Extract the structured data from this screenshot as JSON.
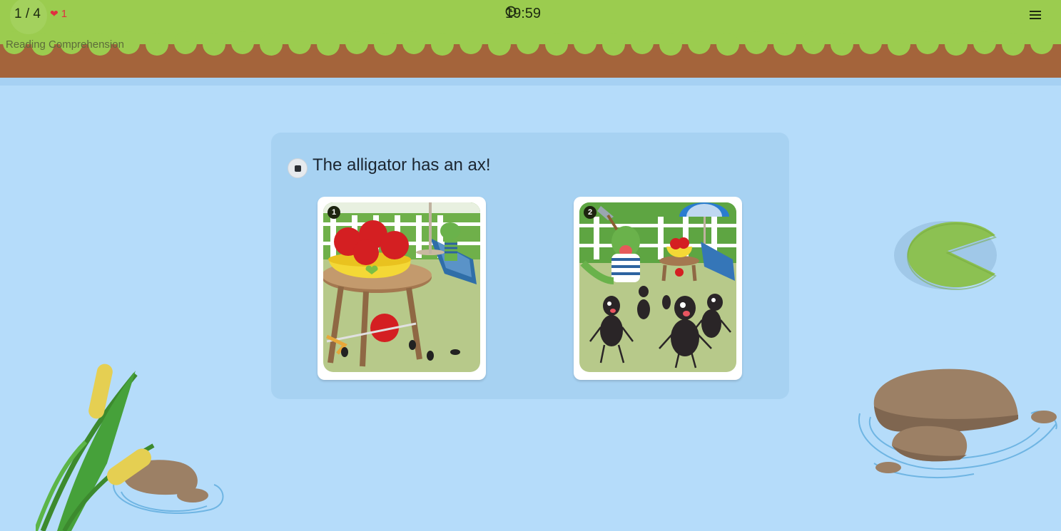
{
  "header": {
    "progress": "1 / 4",
    "lives": "1",
    "timer": "19:59",
    "section_title": "Reading Comprehension",
    "icons": {
      "heart": "heart-icon",
      "clock": "clock-icon",
      "menu": "menu-icon"
    },
    "colors": {
      "grass": "#9bcc4f",
      "dirt": "#a4643b",
      "water": "#b5dcfa"
    }
  },
  "question": {
    "text": "The alligator has an ax!",
    "audio_icon": "stop-icon"
  },
  "choices": [
    {
      "number": "1",
      "description_icon": "apple-bowl-scene-image"
    },
    {
      "number": "2",
      "description_icon": "alligator-with-ax-scene-image"
    }
  ]
}
